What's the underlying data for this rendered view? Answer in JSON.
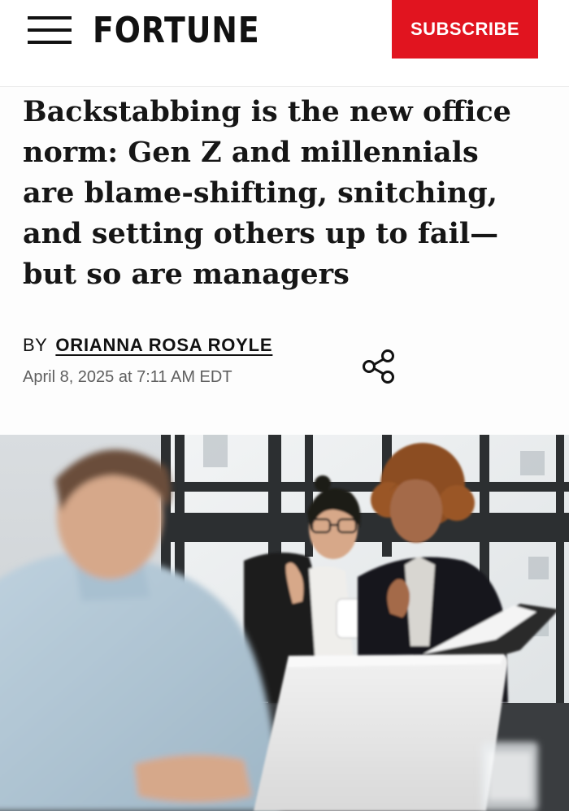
{
  "header": {
    "menu_icon": "hamburger-menu-icon",
    "logo": "FORTUNE",
    "subscribe_label": "SUBSCRIBE",
    "brand_color": "#e1141f"
  },
  "article": {
    "headline": "Backstabbing is the new office norm: Gen Z and millennials are blame-shifting, snitching, and setting others up to fail—but so are managers",
    "byline_prefix": "BY",
    "author": "ORIANNA ROSA ROYLE",
    "date": "April 8, 2025 at 7:11 AM EDT",
    "share_icon": "share-icon"
  },
  "hero_image": {
    "subject": "office-colleagues-whispering-photo"
  }
}
